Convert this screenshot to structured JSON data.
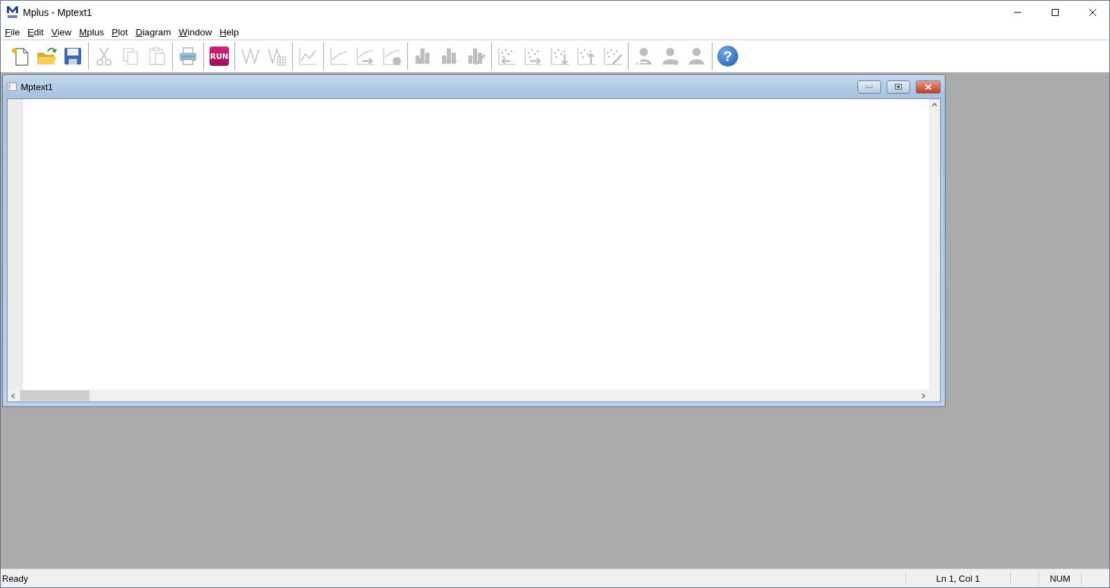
{
  "window": {
    "title": "Mplus - Mptext1"
  },
  "menu": [
    {
      "key": "F",
      "label": "ile"
    },
    {
      "key": "E",
      "label": "dit"
    },
    {
      "key": "V",
      "label": "iew"
    },
    {
      "key": "M",
      "label": "plus"
    },
    {
      "key": "P",
      "label": "lot"
    },
    {
      "key": "D",
      "label": "iagram"
    },
    {
      "key": "W",
      "label": "indow"
    },
    {
      "key": "H",
      "label": "elp"
    }
  ],
  "toolbar": [
    {
      "tools": [
        {
          "kind": "new",
          "disabled": false
        },
        {
          "kind": "open",
          "disabled": false
        },
        {
          "kind": "save",
          "disabled": false
        }
      ]
    },
    {
      "tools": [
        {
          "kind": "cut",
          "disabled": true
        },
        {
          "kind": "copy",
          "disabled": true
        },
        {
          "kind": "paste",
          "disabled": true
        }
      ]
    },
    {
      "tools": [
        {
          "kind": "print",
          "disabled": false
        }
      ]
    },
    {
      "tools": [
        {
          "kind": "run",
          "label": "RUN",
          "disabled": false
        }
      ]
    },
    {
      "tools": [
        {
          "kind": "zigzag",
          "disabled": true
        },
        {
          "kind": "zigzag-table",
          "disabled": true
        }
      ]
    },
    {
      "tools": [
        {
          "kind": "line-plot",
          "disabled": true
        }
      ]
    },
    {
      "tools": [
        {
          "kind": "line",
          "disabled": true
        },
        {
          "kind": "line-arrow",
          "disabled": true
        },
        {
          "kind": "line-info",
          "disabled": true
        }
      ]
    },
    {
      "tools": [
        {
          "kind": "bar-left",
          "disabled": true
        },
        {
          "kind": "bar-right",
          "disabled": true
        },
        {
          "kind": "bar-edit",
          "disabled": true
        }
      ]
    },
    {
      "tools": [
        {
          "kind": "scatter-left",
          "disabled": true
        },
        {
          "kind": "scatter-right",
          "disabled": true
        },
        {
          "kind": "scatter-down",
          "disabled": true
        },
        {
          "kind": "scatter-up",
          "disabled": true
        },
        {
          "kind": "scatter-edit",
          "disabled": true
        }
      ]
    },
    {
      "tools": [
        {
          "kind": "person-left",
          "disabled": true
        },
        {
          "kind": "person-right",
          "disabled": true
        },
        {
          "kind": "person",
          "disabled": true
        }
      ]
    },
    {
      "tools": [
        {
          "kind": "help",
          "label": "?",
          "disabled": false
        }
      ]
    }
  ],
  "document": {
    "title": "Mptext1"
  },
  "status_bar": {
    "message": "Ready",
    "position": "Ln 1, Col 1",
    "num": "NUM"
  }
}
